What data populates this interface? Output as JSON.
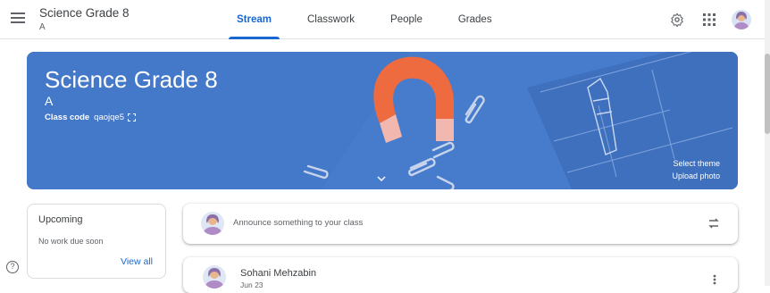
{
  "header": {
    "class_name": "Science Grade 8",
    "section": "A",
    "tabs": [
      {
        "label": "Stream",
        "active": true
      },
      {
        "label": "Classwork",
        "active": false
      },
      {
        "label": "People",
        "active": false
      },
      {
        "label": "Grades",
        "active": false
      }
    ],
    "icons": [
      "menu-icon",
      "settings-icon",
      "apps-grid-icon",
      "account-avatar"
    ]
  },
  "banner": {
    "title": "Science Grade 8",
    "section": "A",
    "class_code_label": "Class code",
    "class_code": "qaojqe5",
    "select_theme": "Select theme",
    "upload_photo": "Upload photo",
    "color": "#4478c8"
  },
  "upcoming": {
    "title": "Upcoming",
    "empty_text": "No work due soon",
    "view_all": "View all"
  },
  "announce": {
    "placeholder": "Announce something to your class"
  },
  "post": {
    "author": "Sohani Mehzabin",
    "date": "Jun 23"
  },
  "colors": {
    "accent": "#1967d2"
  }
}
